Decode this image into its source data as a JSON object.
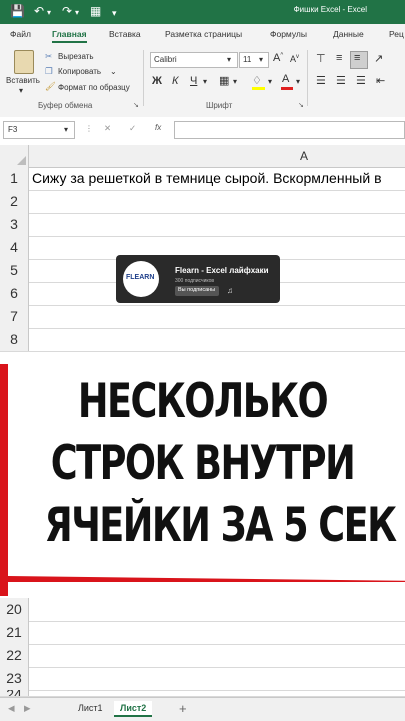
{
  "titlebar": {
    "title": "Фишки Excel  -  Excel"
  },
  "tabs": [
    {
      "label": "Файл"
    },
    {
      "label": "Главная"
    },
    {
      "label": "Вставка"
    },
    {
      "label": "Разметка страницы"
    },
    {
      "label": "Формулы"
    },
    {
      "label": "Данные"
    },
    {
      "label": "Рец"
    }
  ],
  "ribbon": {
    "paste_label": "Вставить",
    "cut_label": "Вырезать",
    "copy_label": "Копировать",
    "format_painter_label": "Формат по образцу",
    "clipboard_group": "Буфер обмена",
    "font_name": "Calibri",
    "font_size": "11",
    "font_group": "Шрифт",
    "bold": "Ж",
    "italic": "К",
    "underline": "Ч"
  },
  "formula_bar": {
    "name_box": "F3",
    "fx": "fx",
    "value": ""
  },
  "column_header": "A",
  "rows": [
    {
      "num": "1",
      "text": "Сижу за решеткой в темнице сырой. Вскормленный в"
    },
    {
      "num": "2",
      "text": ""
    },
    {
      "num": "3",
      "text": ""
    },
    {
      "num": "4",
      "text": ""
    },
    {
      "num": "5",
      "text": ""
    },
    {
      "num": "6",
      "text": ""
    },
    {
      "num": "7",
      "text": ""
    },
    {
      "num": "8",
      "text": ""
    }
  ],
  "bottom_rows": [
    {
      "num": "20"
    },
    {
      "num": "21"
    },
    {
      "num": "22"
    },
    {
      "num": "23"
    },
    {
      "num": "24"
    }
  ],
  "overlay": {
    "logo": "FLEARN",
    "channel": "Flearn - Excel лайфхаки",
    "subscribers": "300 подписчиков",
    "subscribed_button": "Вы подписаны"
  },
  "banner": {
    "line1": "НЕСКОЛЬКО",
    "line2": "СТРОК ВНУТРИ",
    "line3": "ЯЧЕЙКИ ЗА 5 СЕК",
    "accent_color": "#d9141b"
  },
  "sheets": [
    {
      "label": "Лист1"
    },
    {
      "label": "Лист2"
    }
  ],
  "add_sheet": "+"
}
